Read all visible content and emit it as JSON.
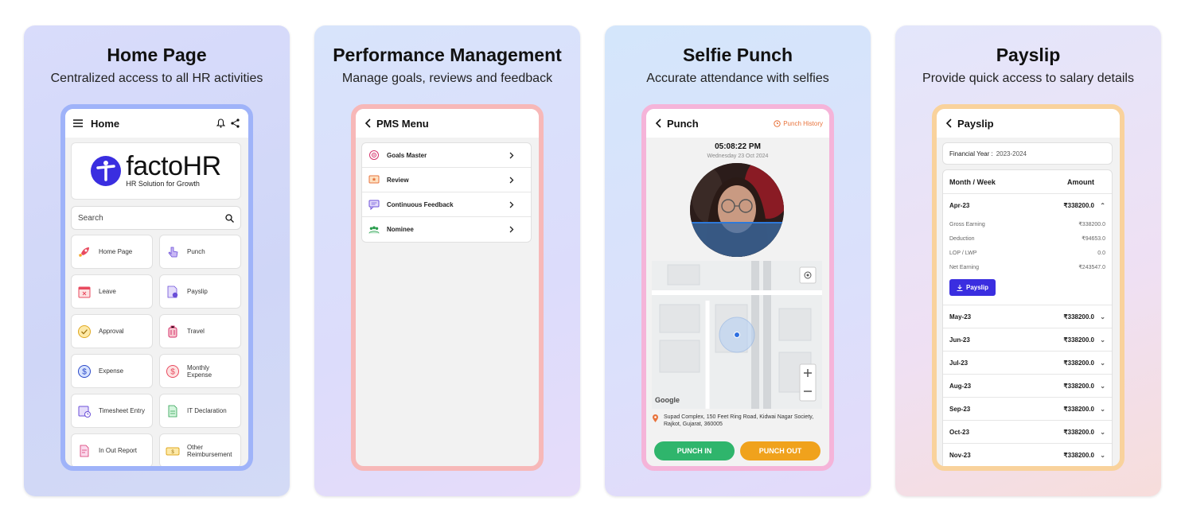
{
  "cards": [
    {
      "title": "Home Page",
      "subtitle": "Centralized access to all HR activities",
      "appbar_title": "Home",
      "logo_text": "factoHR",
      "logo_tagline": "HR Solution for Growth",
      "search_placeholder": "Search",
      "tiles": [
        {
          "label": "Home Page",
          "icon": "rocket-icon"
        },
        {
          "label": "Punch",
          "icon": "tap-hand-icon"
        },
        {
          "label": "Leave",
          "icon": "calendar-x-icon"
        },
        {
          "label": "Payslip",
          "icon": "payslip-document-icon"
        },
        {
          "label": "Approval",
          "icon": "check-circle-icon"
        },
        {
          "label": "Travel",
          "icon": "luggage-icon"
        },
        {
          "label": "Expense",
          "icon": "dollar-coin-icon"
        },
        {
          "label": "Monthly Expense",
          "icon": "dollar-cycle-icon"
        },
        {
          "label": "Timesheet Entry",
          "icon": "timesheet-calendar-icon"
        },
        {
          "label": "IT Declaration",
          "icon": "tax-document-icon"
        },
        {
          "label": "In Out Report",
          "icon": "report-document-icon"
        },
        {
          "label": "Other Reimbursement",
          "icon": "reimbursement-ticket-icon"
        }
      ]
    },
    {
      "title": "Performance Management",
      "subtitle": "Manage goals, reviews and feedback",
      "appbar_title": "PMS Menu",
      "menu": [
        {
          "label": "Goals Master",
          "icon": "target-icon"
        },
        {
          "label": "Review",
          "icon": "review-star-icon"
        },
        {
          "label": "Continuous Feedback",
          "icon": "feedback-chat-icon"
        },
        {
          "label": "Nominee",
          "icon": "people-group-icon"
        }
      ]
    },
    {
      "title": "Selfie Punch",
      "subtitle": "Accurate attendance with selfies",
      "appbar_title": "Punch",
      "history_label": "Punch History",
      "time": "05:08:22 PM",
      "date": "Wednesday 23 Oct 2024",
      "map_brand": "Google",
      "address": "Supad Complex, 150 Feet Ring Road, Kidwai Nagar Society, Rajkot, Gujarat, 360005",
      "punch_in": "PUNCH IN",
      "punch_out": "PUNCH OUT"
    },
    {
      "title": "Payslip",
      "subtitle": "Provide quick access to salary details",
      "appbar_title": "Payslip",
      "fy_label": "Financial Year :",
      "fy_value": "2023-2024",
      "col_month": "Month / Week",
      "col_amount": "Amount",
      "expanded": {
        "month": "Apr-23",
        "amount": "₹338200.0",
        "details": [
          {
            "label": "Gross Earning",
            "value": "₹338200.0"
          },
          {
            "label": "Deduction",
            "value": "₹94653.0"
          },
          {
            "label": "LOP / LWP",
            "value": "0.0"
          },
          {
            "label": "Net Earning",
            "value": "₹243547.0"
          }
        ],
        "button": "Payslip"
      },
      "rows": [
        {
          "month": "May-23",
          "amount": "₹338200.0"
        },
        {
          "month": "Jun-23",
          "amount": "₹338200.0"
        },
        {
          "month": "Jul-23",
          "amount": "₹338200.0"
        },
        {
          "month": "Aug-23",
          "amount": "₹338200.0"
        },
        {
          "month": "Sep-23",
          "amount": "₹338200.0"
        },
        {
          "month": "Oct-23",
          "amount": "₹338200.0"
        },
        {
          "month": "Nov-23",
          "amount": "₹338200.0"
        }
      ]
    }
  ],
  "colors": {
    "brand_blue": "#3a2ee0",
    "punch_in": "#2fb56c",
    "punch_out": "#f0a21c",
    "history_orange": "#e8733c"
  }
}
